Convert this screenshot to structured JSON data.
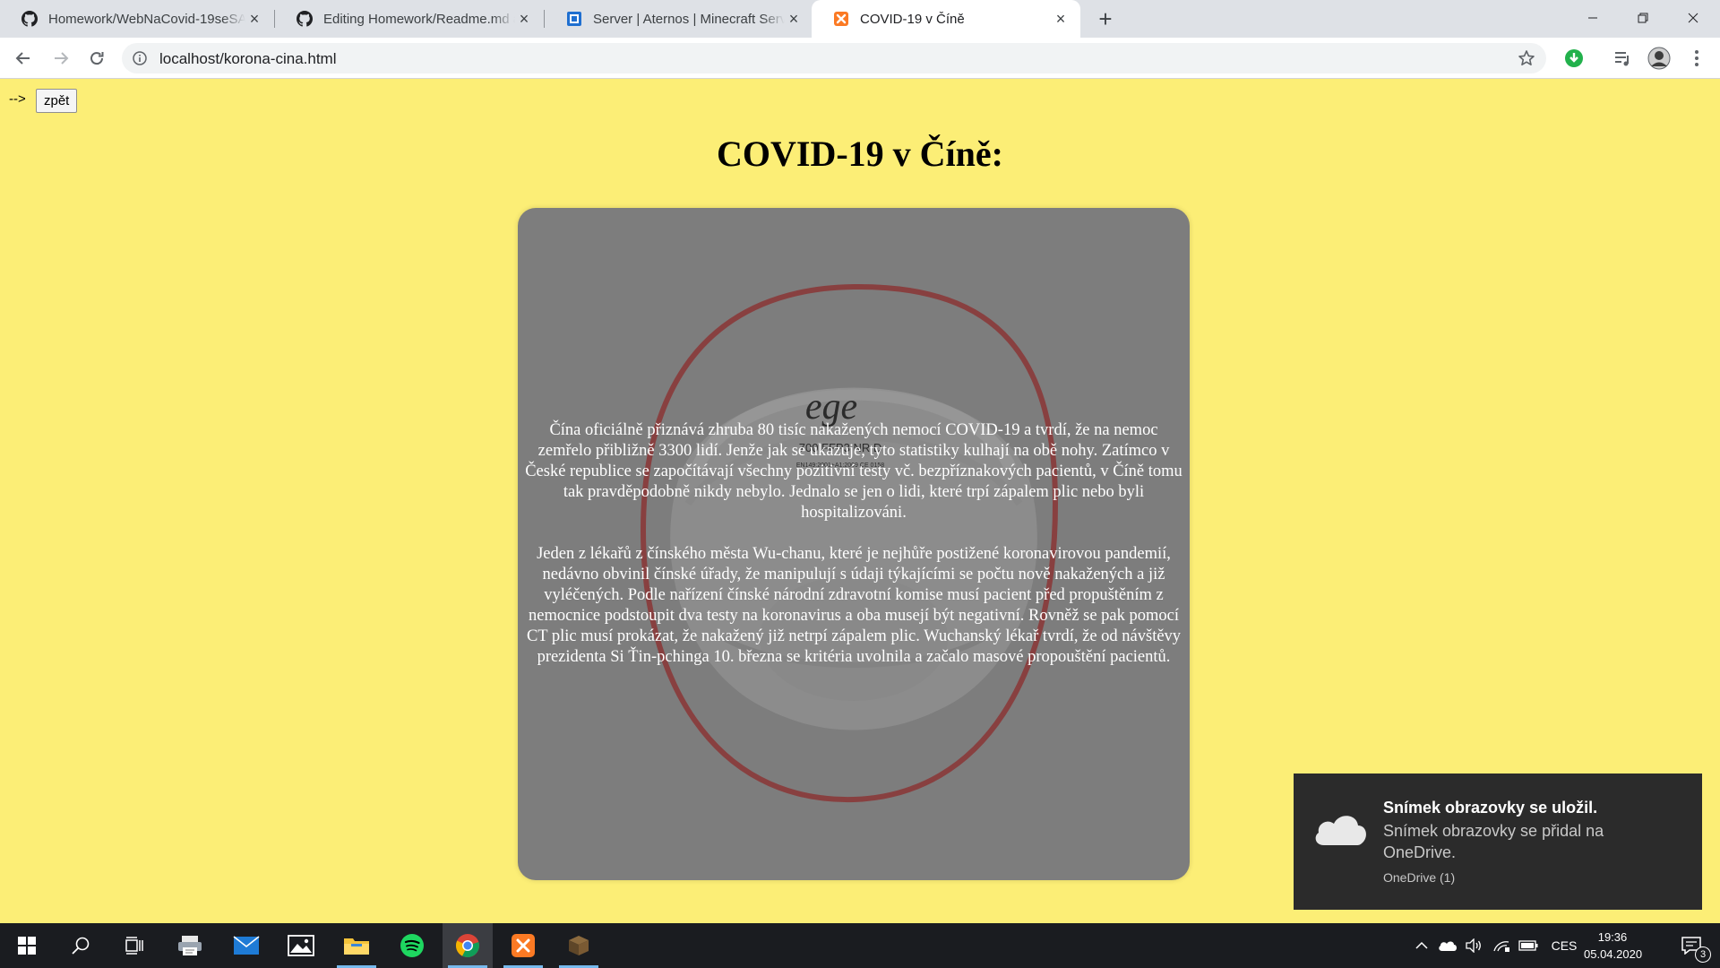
{
  "browser": {
    "tabs": [
      {
        "title": "Homework/WebNaCovid-19seSA",
        "icon": "github-icon"
      },
      {
        "title": "Editing Homework/Readme.md a",
        "icon": "github-icon"
      },
      {
        "title": "Server | Aternos | Minecraft Serve",
        "icon": "aternos-icon"
      },
      {
        "title": "COVID-19 v Číně",
        "icon": "xampp-icon"
      }
    ],
    "url": "localhost/korona-cina.html"
  },
  "page": {
    "arrow_text": "-->",
    "back_button": "zpět",
    "title": "COVID-19 v Číně:",
    "paragraphs": [
      "Čína oficiálně přiznává zhruba 80 tisíc nakažených nemocí COVID-19 a tvrdí, že na nemoc zemřelo přibližně 3300 lidí. Jenže jak se ukazuje, tyto statistiky kulhají na obě nohy. Zatímco v České republice se započítávají všechny pozitivní testy vč. bezpříznakových pacientů, v Číně tomu tak pravděpodobně nikdy nebylo. Jednalo se jen o lidi, které trpí zápalem plic nebo byli hospitalizováni.",
      "Jeden z lékařů z čínského města Wu-chanu, které je nejhůře postižené koronavirovou pandemií, nedávno obvinil čínské úřady, že manipulují s údaji týkajícími se počtu nově nakažených a již vyléčených. Podle nařízení čínské národní zdravotní komise musí pacient před propuštěním z nemocnice podstoupit dva testy na koronavirus a oba musejí být negativní. Rovněž se pak pomocí CT plic musí prokázat, že nakažený již netrpí zápalem plic. Wuchanský lékař tvrdí, že od návštěvy prezidenta Si Ťin-pchinga 10. března se kritéria uvolnila a začalo masové propouštění pacientů."
    ],
    "image": {
      "brand": "ege",
      "model": "700 FFP3 NR D",
      "small": "EN149:2001+A1:2009   CE 0158"
    }
  },
  "toast": {
    "title": "Snímek obrazovky se uložil.",
    "body": "Snímek obrazovky se přidal na OneDrive.",
    "app": "OneDrive (1)"
  },
  "taskbar": {
    "language": "CES",
    "time": "19:36",
    "date": "05.04.2020",
    "notification_count": "3"
  }
}
